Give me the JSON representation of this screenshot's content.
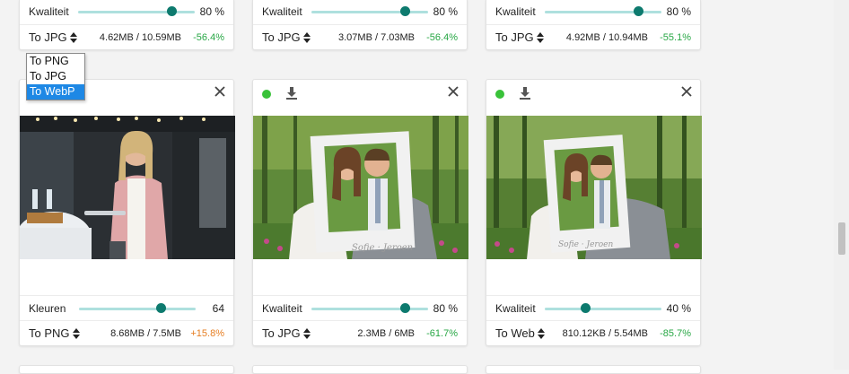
{
  "colors": {
    "accent": "#0d7a6e",
    "track": "#aee0de",
    "positive": "#28a745",
    "negative": "#e67e22",
    "status": "#39c239"
  },
  "top_cards": [
    {
      "quality_label": "Kwaliteit",
      "quality_value": "80 %",
      "quality_level": 0.8,
      "format_label": "To JPG",
      "sizes": "4.62MB / 10.59MB",
      "percent": "-56.4%",
      "percent_sign": "negative-good"
    },
    {
      "quality_label": "Kwaliteit",
      "quality_value": "80 %",
      "quality_level": 0.8,
      "format_label": "To JPG",
      "sizes": "3.07MB / 7.03MB",
      "percent": "-56.4%",
      "percent_sign": "negative-good"
    },
    {
      "quality_label": "Kwaliteit",
      "quality_value": "80 %",
      "quality_level": 0.8,
      "format_label": "To JPG",
      "sizes": "4.92MB / 10.94MB",
      "percent": "-55.1%",
      "percent_sign": "negative-good"
    }
  ],
  "dropdown": {
    "options": [
      "To PNG",
      "To JPG",
      "To WebP"
    ],
    "selected_index": 2
  },
  "bottom_cards": [
    {
      "status_icon": "none",
      "photo": "woman-speaking-photo",
      "slider_label": "Kleuren",
      "slider_value": "64",
      "slider_level": 0.7,
      "format_label": "To PNG",
      "sizes": "8.68MB / 7.5MB",
      "percent": "+15.8%",
      "percent_sign": "positive-bad"
    },
    {
      "status_icon": "done",
      "photo": "couple-frame-photo",
      "slider_label": "Kwaliteit",
      "slider_value": "80 %",
      "slider_level": 0.8,
      "format_label": "To JPG",
      "sizes": "2.3MB / 6MB",
      "percent": "-61.7%",
      "percent_sign": "negative-good"
    },
    {
      "status_icon": "done",
      "photo": "couple-frame-photo",
      "slider_label": "Kwaliteit",
      "slider_value": "40 %",
      "slider_level": 0.35,
      "format_label": "To WebP",
      "sizes": "810.12KB / 5.54MB",
      "percent": "-85.7%",
      "percent_sign": "negative-good"
    }
  ],
  "icons": {
    "download": "download-icon",
    "close": "close-icon",
    "status": "status-dot-icon",
    "select_arrows": "select-arrows-icon"
  },
  "scrollbar": {
    "position": 0.6
  }
}
